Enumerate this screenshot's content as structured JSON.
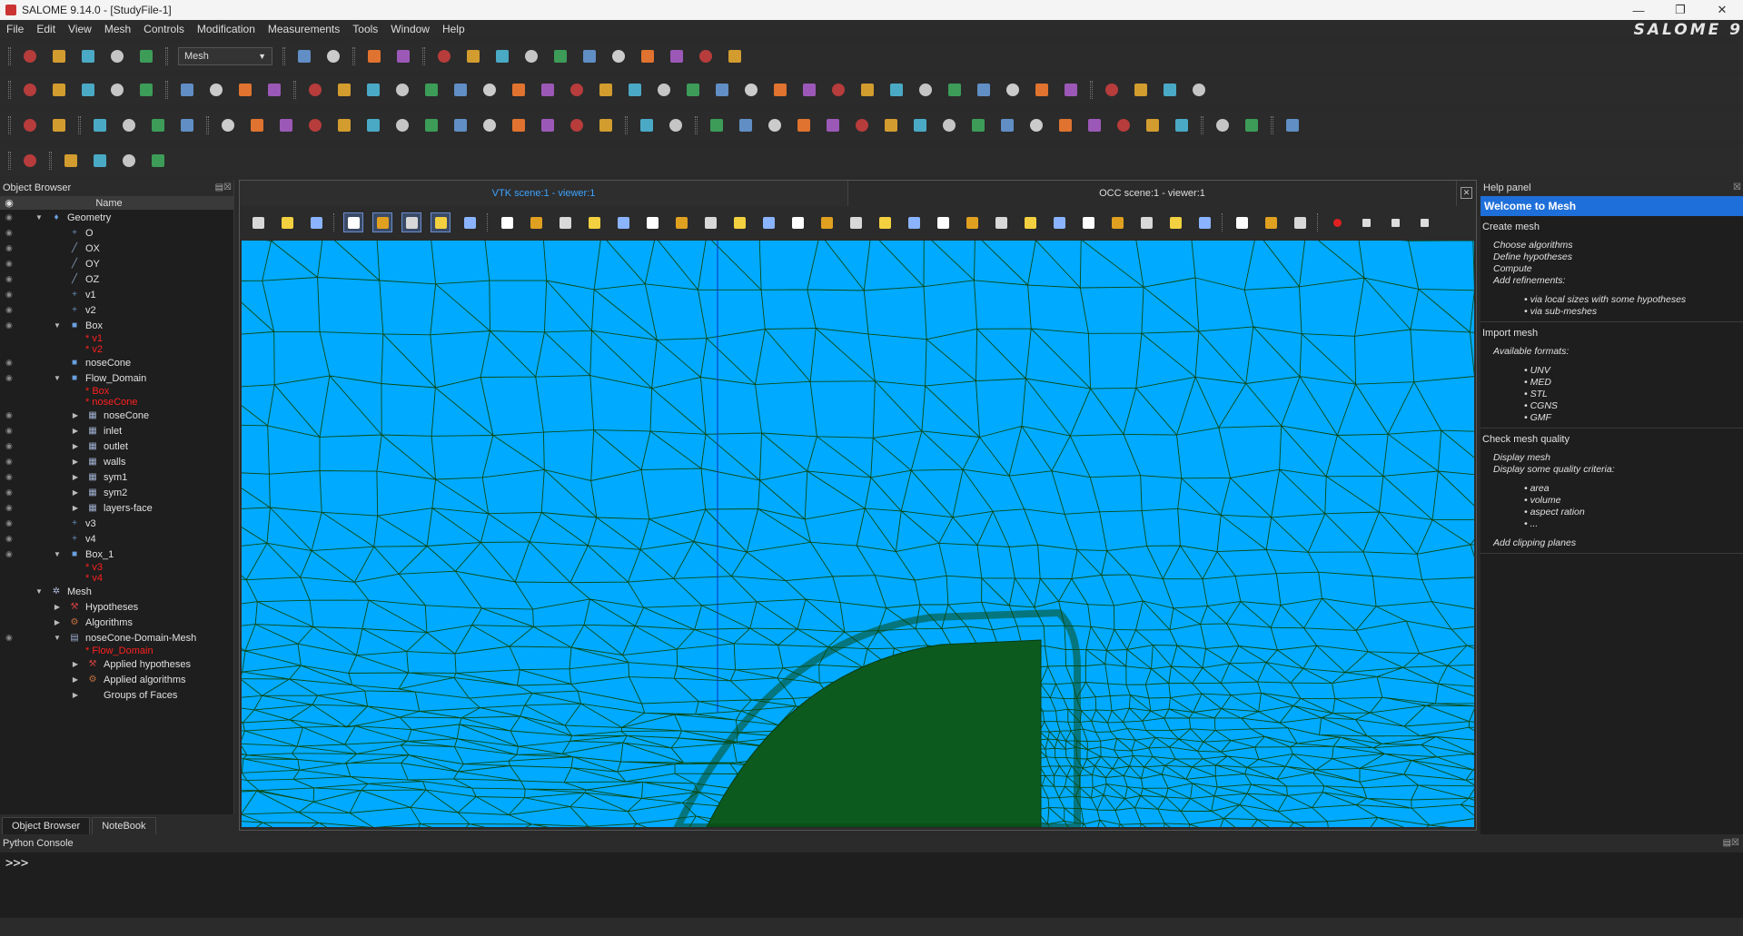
{
  "window": {
    "title": "SALOME 9.14.0 - [StudyFile-1]",
    "brand": "SALOME 9"
  },
  "menu": [
    "File",
    "Edit",
    "View",
    "Mesh",
    "Controls",
    "Modification",
    "Measurements",
    "Tools",
    "Window",
    "Help"
  ],
  "module_combo": {
    "value": "Mesh"
  },
  "object_browser": {
    "title": "Object Browser",
    "column_name": "Name",
    "tree": [
      {
        "label": "Geometry",
        "level": 0,
        "toggle": "open",
        "icon": "geometry-icon",
        "eye": true
      },
      {
        "label": "O",
        "level": 1,
        "icon": "point-icon",
        "eye": true
      },
      {
        "label": "OX",
        "level": 1,
        "icon": "vector-icon",
        "eye": true
      },
      {
        "label": "OY",
        "level": 1,
        "icon": "vector-icon",
        "eye": true
      },
      {
        "label": "OZ",
        "level": 1,
        "icon": "vector-icon",
        "eye": true
      },
      {
        "label": "v1",
        "level": 1,
        "icon": "point-icon",
        "eye": true
      },
      {
        "label": "v2",
        "level": 1,
        "icon": "point-icon",
        "eye": true
      },
      {
        "label": "Box",
        "level": 1,
        "toggle": "open",
        "icon": "solid-icon",
        "eye": true
      },
      {
        "label": "* v1",
        "level": 2,
        "ref": true,
        "eye": false
      },
      {
        "label": "* v2",
        "level": 2,
        "ref": true,
        "eye": false
      },
      {
        "label": "noseCone",
        "level": 1,
        "icon": "solid-icon",
        "eye": true
      },
      {
        "label": "Flow_Domain",
        "level": 1,
        "toggle": "open",
        "icon": "solid-icon",
        "eye": true
      },
      {
        "label": "* Box",
        "level": 2,
        "ref": true,
        "eye": false
      },
      {
        "label": "* noseCone",
        "level": 2,
        "ref": true,
        "eye": false
      },
      {
        "label": "noseCone",
        "level": 2,
        "toggle": "closed",
        "icon": "group-icon",
        "eye": true
      },
      {
        "label": "inlet",
        "level": 2,
        "toggle": "closed",
        "icon": "group-icon",
        "eye": true
      },
      {
        "label": "outlet",
        "level": 2,
        "toggle": "closed",
        "icon": "group-icon",
        "eye": true
      },
      {
        "label": "walls",
        "level": 2,
        "toggle": "closed",
        "icon": "group-icon",
        "eye": true
      },
      {
        "label": "sym1",
        "level": 2,
        "toggle": "closed",
        "icon": "group-icon",
        "eye": true
      },
      {
        "label": "sym2",
        "level": 2,
        "toggle": "closed",
        "icon": "group-icon",
        "eye": true
      },
      {
        "label": "layers-face",
        "level": 2,
        "toggle": "closed",
        "icon": "group-icon",
        "eye": true
      },
      {
        "label": "v3",
        "level": 1,
        "icon": "point-icon",
        "eye": true
      },
      {
        "label": "v4",
        "level": 1,
        "icon": "point-icon",
        "eye": true
      },
      {
        "label": "Box_1",
        "level": 1,
        "toggle": "open",
        "icon": "solid-icon",
        "eye": true
      },
      {
        "label": "* v3",
        "level": 2,
        "ref": true,
        "eye": false
      },
      {
        "label": "* v4",
        "level": 2,
        "ref": true,
        "eye": false
      },
      {
        "label": "Mesh",
        "level": 0,
        "toggle": "open",
        "icon": "mesh-module-icon",
        "eye": false
      },
      {
        "label": "Hypotheses",
        "level": 1,
        "toggle": "closed",
        "icon": "hypothesis-icon",
        "eye": false
      },
      {
        "label": "Algorithms",
        "level": 1,
        "toggle": "closed",
        "icon": "algorithm-icon",
        "eye": false
      },
      {
        "label": "noseCone-Domain-Mesh",
        "level": 1,
        "toggle": "open",
        "icon": "mesh-icon",
        "eye": true
      },
      {
        "label": "* Flow_Domain",
        "level": 2,
        "ref": true,
        "eye": false
      },
      {
        "label": "Applied hypotheses",
        "level": 2,
        "toggle": "closed",
        "icon": "hypothesis-icon",
        "eye": false
      },
      {
        "label": "Applied algorithms",
        "level": 2,
        "toggle": "closed",
        "icon": "algorithm-icon",
        "eye": false
      },
      {
        "label": "Groups of Faces",
        "level": 2,
        "toggle": "closed",
        "icon": "",
        "eye": false
      }
    ],
    "tabs": [
      "Object Browser",
      "NoteBook"
    ]
  },
  "viewer": {
    "tabs": [
      "VTK scene:1 - viewer:1",
      "OCC scene:1 - viewer:1"
    ],
    "background": "#00aaff",
    "mesh_color": "#0a4a14"
  },
  "help": {
    "title": "Help panel",
    "header": "Welcome to Mesh",
    "sections": [
      {
        "heading": "Create mesh",
        "items": [
          "Choose algorithms",
          "Define hypotheses",
          "Compute",
          "Add refinements:"
        ],
        "bullets": [
          "via local sizes with some hypotheses",
          "via sub-meshes"
        ],
        "after": []
      },
      {
        "heading": "Import mesh",
        "items": [
          "Available formats:"
        ],
        "bullets": [
          "UNV",
          "MED",
          "STL",
          "CGNS",
          "GMF"
        ],
        "after": []
      },
      {
        "heading": "Check mesh quality",
        "items": [
          "Display mesh",
          "Display some quality criteria:"
        ],
        "bullets": [
          "area",
          "volume",
          "aspect ration",
          "..."
        ],
        "after": [
          "Add clipping planes"
        ]
      }
    ]
  },
  "console": {
    "title": "Python Console",
    "prompt": ">>>"
  }
}
